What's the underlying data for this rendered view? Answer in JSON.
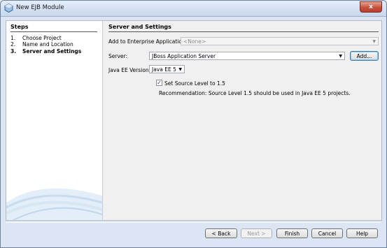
{
  "window": {
    "title": "New EJB Module",
    "close_label": "x"
  },
  "steps": {
    "title": "Steps",
    "items": [
      {
        "num": "1.",
        "label": "Choose Project"
      },
      {
        "num": "2.",
        "label": "Name and Location"
      },
      {
        "num": "3.",
        "label": "Server and Settings"
      }
    ]
  },
  "panel": {
    "title": "Server and Settings",
    "enterprise_label": "Add to Enterprise Application:",
    "enterprise_value": "<None>",
    "server_label": "Server:",
    "server_value": "JBoss Application Server",
    "add_label": "Add...",
    "javaee_label": "Java EE Version:",
    "javaee_value": "Java EE 5",
    "source_level_label": "Set Source Level to 1.5",
    "source_level_checked": true,
    "recommendation": "Recommendation: Source Level 1.5 should be used in Java EE 5 projects."
  },
  "buttons": {
    "back": "< Back",
    "next": "Next >",
    "finish": "Finish",
    "cancel": "Cancel",
    "help": "Help"
  },
  "icons": {
    "arrow_down": "▼",
    "check": "✓"
  }
}
